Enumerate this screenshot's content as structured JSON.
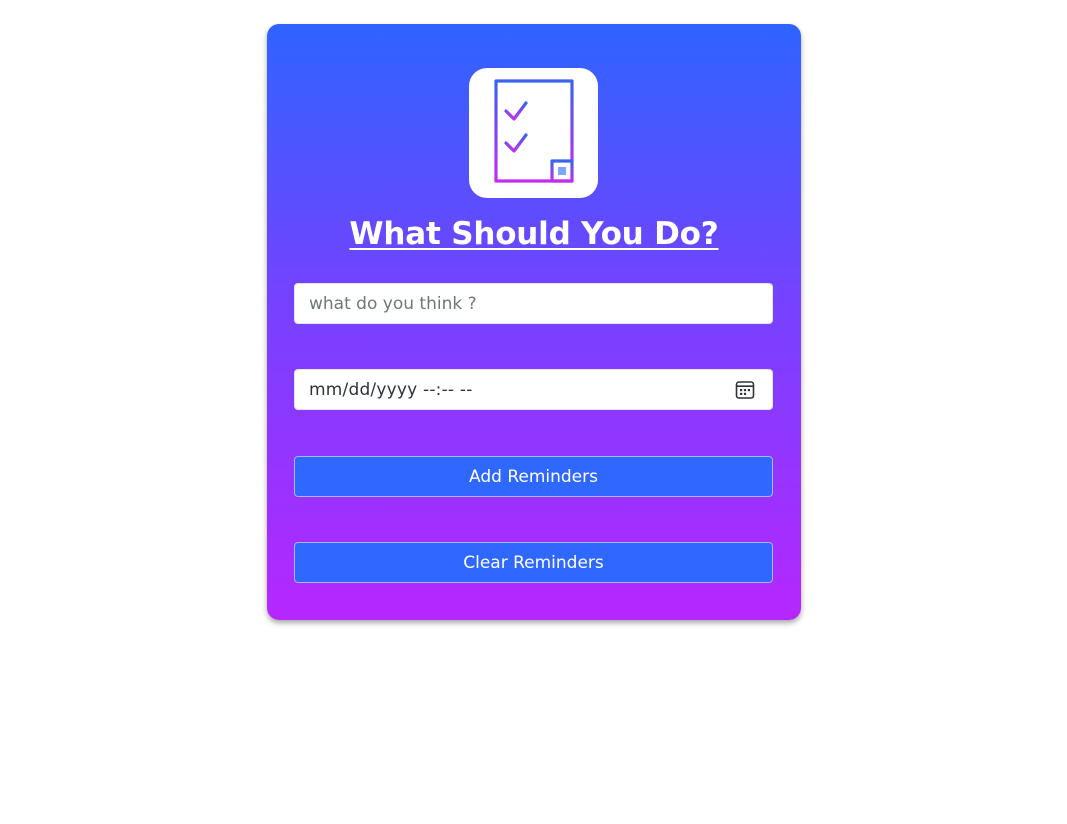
{
  "app": {
    "logo_icon": "checklist-icon",
    "title": "What Should You Do?"
  },
  "form": {
    "task_placeholder": "what do you think ?",
    "task_value": "",
    "datetime_placeholder": "mm/dd/yyyy --:-- --",
    "datetime_icon": "calendar-icon"
  },
  "actions": {
    "add_label": "Add Reminders",
    "clear_label": "Clear Reminders"
  },
  "colors": {
    "gradient_top": "#2f63ff",
    "gradient_bottom": "#b527ff",
    "button_bg": "#2f68ff"
  }
}
